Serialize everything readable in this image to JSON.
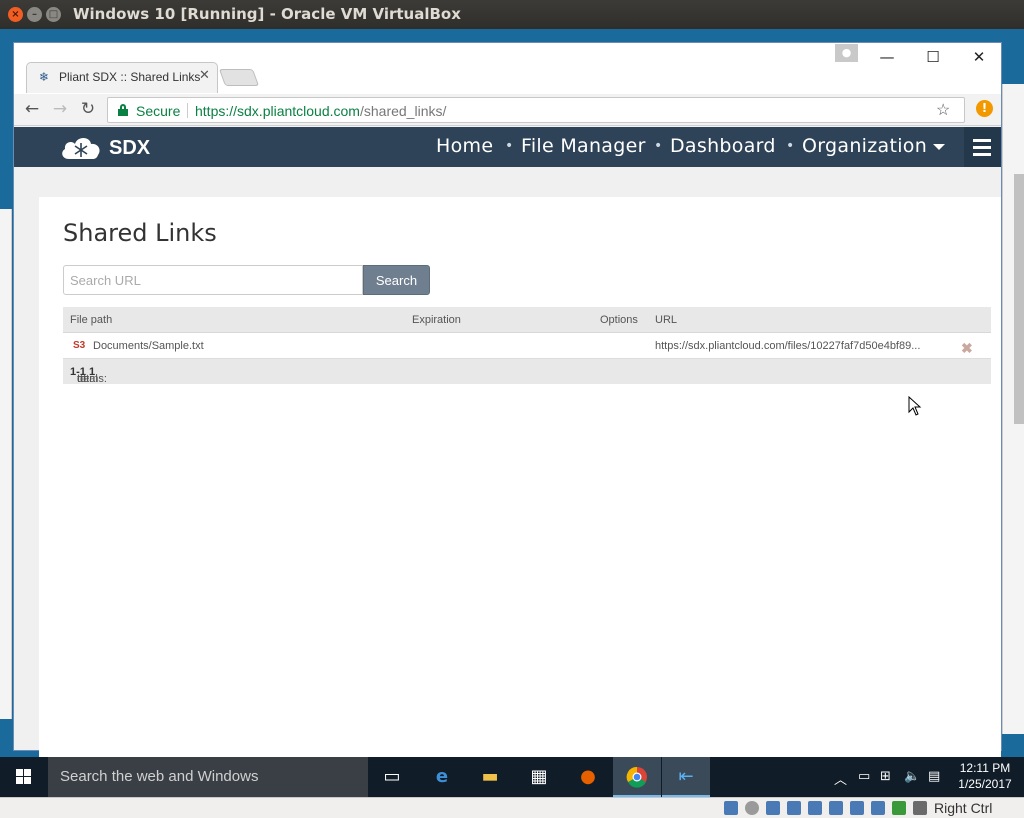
{
  "host": {
    "title": "Windows 10 [Running] - Oracle VM VirtualBox",
    "host_key": "Right Ctrl"
  },
  "browser": {
    "tab_title": "Pliant SDX :: Shared Links",
    "secure_label": "Secure",
    "url_scheme_host": "https://sdx.pliantcloud.com",
    "url_path": "/shared_links/"
  },
  "site": {
    "logo_text": "SDX",
    "nav": [
      "Home",
      "File Manager",
      "Dashboard",
      "Organization"
    ]
  },
  "page": {
    "title": "Shared Links",
    "search_placeholder": "Search URL",
    "search_button": "Search"
  },
  "table": {
    "columns": [
      "File path",
      "Expiration",
      "Options",
      "URL"
    ],
    "rows": [
      {
        "file_path": "Documents/Sample.txt",
        "expiration": "",
        "options": "",
        "url": "https://sdx.pliantcloud.com/files/10227faf7d50e4bf89..."
      }
    ],
    "footer": {
      "label": "Items:",
      "range": "1-1",
      "of": "of",
      "total": "1",
      "suffix": "total"
    }
  },
  "taskbar": {
    "search_placeholder": "Search the web and Windows",
    "time": "12:11 PM",
    "date": "1/25/2017"
  }
}
